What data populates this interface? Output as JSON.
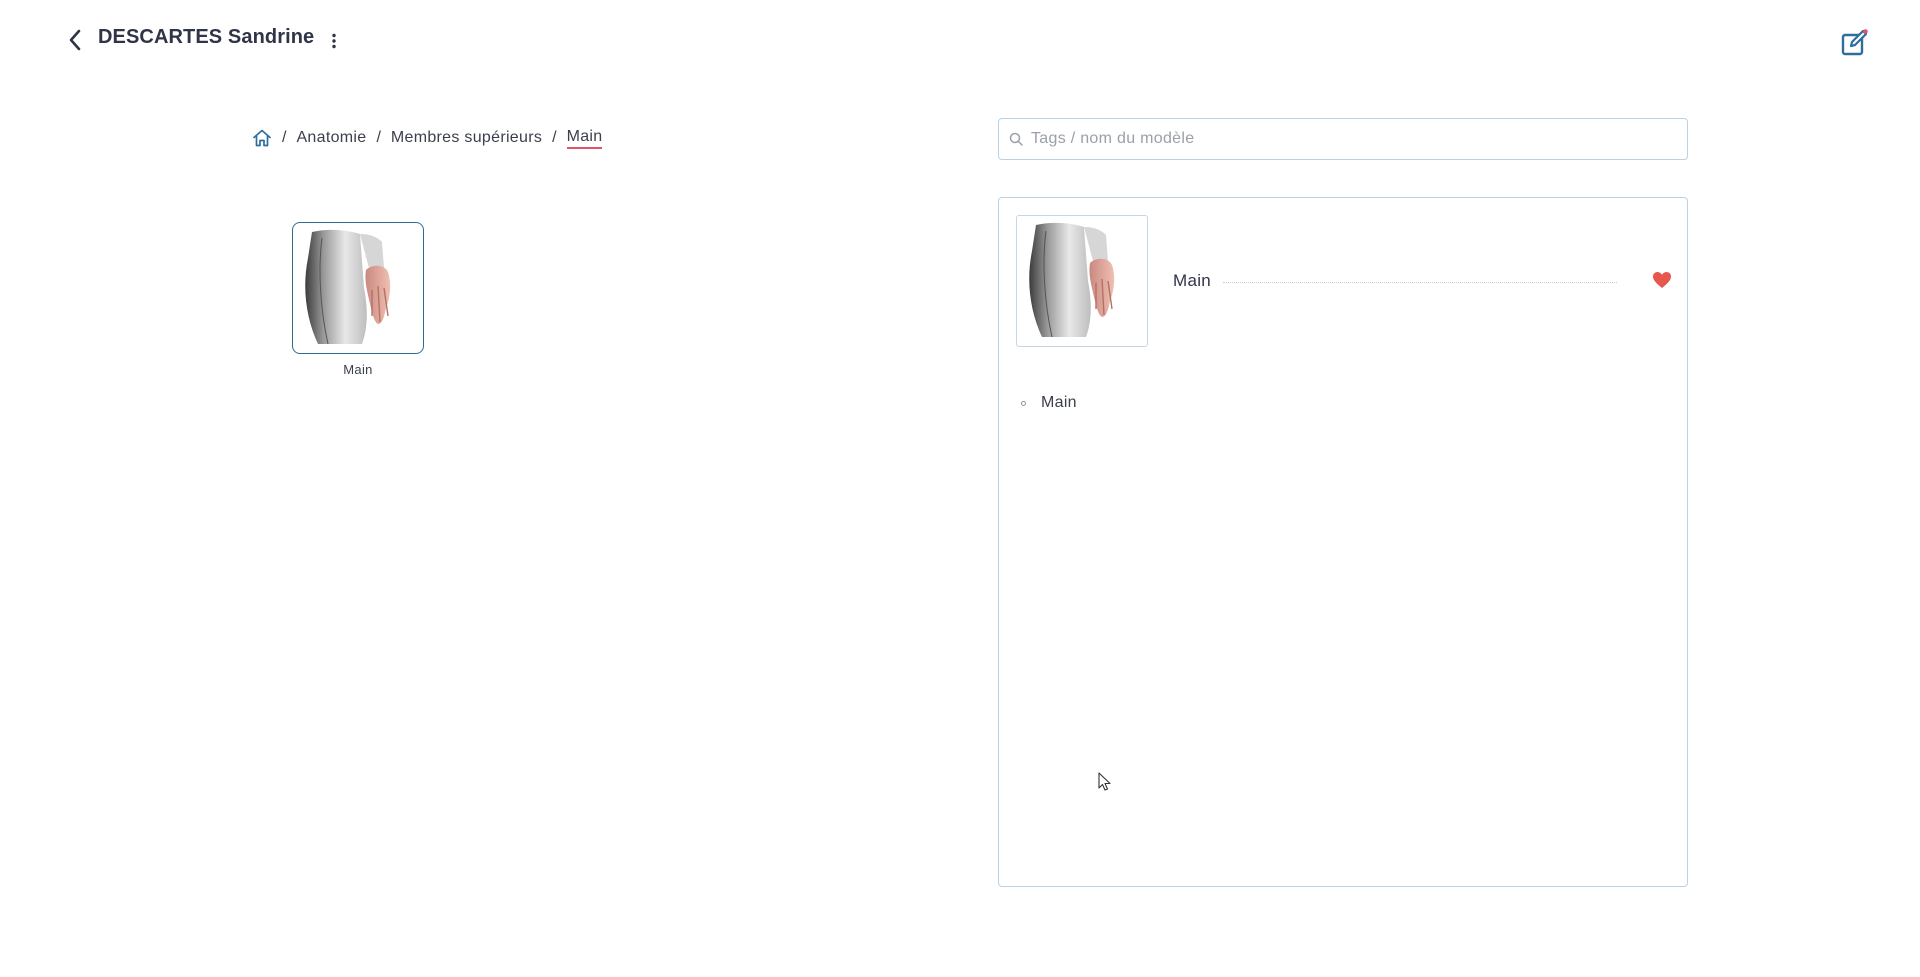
{
  "header": {
    "patient_name": "DESCARTES Sandrine",
    "back_icon": "chevron-left-icon",
    "menu_icon": "kebab-icon",
    "edit_icon": "edit-note-icon"
  },
  "breadcrumb": {
    "home_icon": "home-icon",
    "items": [
      {
        "label": "Anatomie"
      },
      {
        "label": "Membres supérieurs"
      },
      {
        "label": "Main"
      }
    ],
    "separator": "/"
  },
  "grid": {
    "items": [
      {
        "label": "Main"
      }
    ]
  },
  "search": {
    "placeholder": "Tags / nom du modèle",
    "value": ""
  },
  "detail": {
    "title": "Main",
    "favorite": true,
    "list": [
      {
        "label": "Main"
      }
    ]
  },
  "colors": {
    "accent_border": "#2f6b8f",
    "active_underline": "#e0546b",
    "heart": "#e5574f",
    "edit_icon": "#2d6e9c"
  }
}
